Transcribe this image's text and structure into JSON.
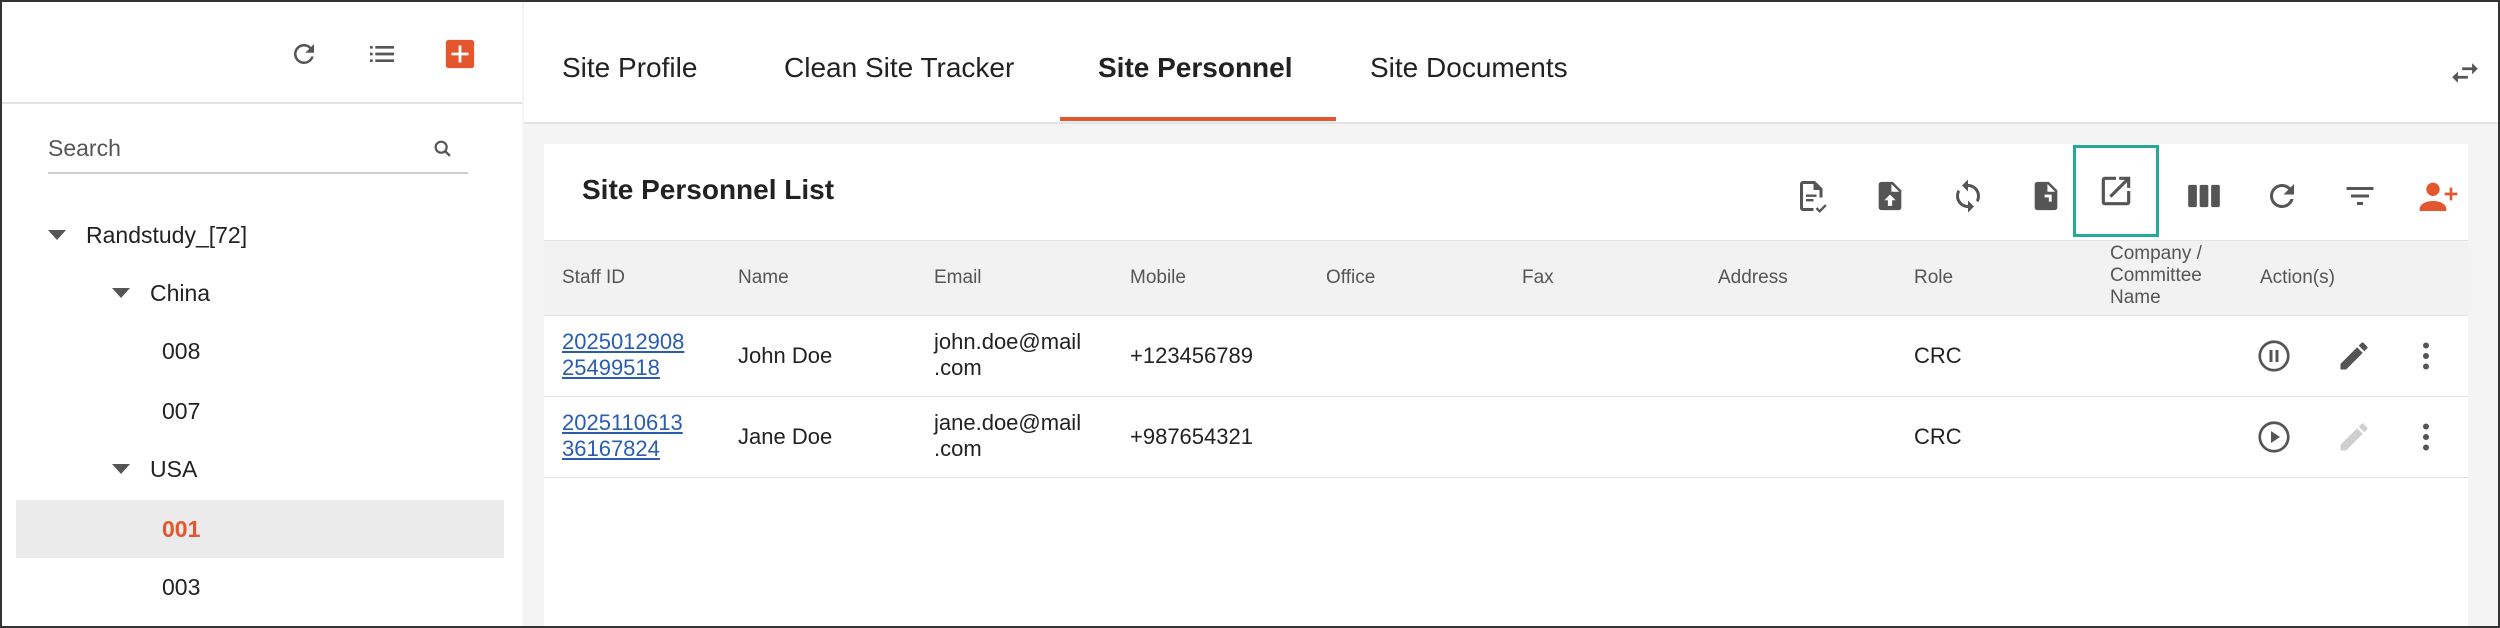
{
  "sidebar": {
    "search": {
      "placeholder": "Search",
      "value": ""
    },
    "tree": [
      {
        "label": "Randstudy_[72]",
        "expanded": true
      },
      {
        "label": "China",
        "expanded": true
      },
      {
        "label": "008"
      },
      {
        "label": "007"
      },
      {
        "label": "USA",
        "expanded": true
      },
      {
        "label": "001",
        "selected": true
      },
      {
        "label": "003"
      }
    ]
  },
  "tabs": [
    {
      "label": "Site Profile"
    },
    {
      "label": "Clean Site Tracker"
    },
    {
      "label": "Site Personnel",
      "active": true
    },
    {
      "label": "Site Documents"
    }
  ],
  "card": {
    "title": "Site Personnel List",
    "columns": [
      "Staff ID",
      "Name",
      "Email",
      "Mobile",
      "Office",
      "Fax",
      "Address",
      "Role",
      "Company / Committee Name",
      "Action(s)"
    ],
    "rows": [
      {
        "staff_id": "2025012908 25499518",
        "name": "John Doe",
        "email": "john.doe@mail .com",
        "mobile": "+123456789",
        "office": "",
        "fax": "",
        "address": "",
        "role": "CRC",
        "company": "",
        "status_action": "pause-icon",
        "edit_enabled": true
      },
      {
        "staff_id": "2025110613 36167824",
        "name": "Jane Doe",
        "email": "jane.doe@mail .com",
        "mobile": "+987654321",
        "office": "",
        "fax": "",
        "address": "",
        "role": "CRC",
        "company": "",
        "status_action": "play-icon",
        "edit_enabled": false
      }
    ]
  },
  "colors": {
    "accent": "#e4572e",
    "highlight": "#25a99a",
    "link": "#2a5db0"
  }
}
